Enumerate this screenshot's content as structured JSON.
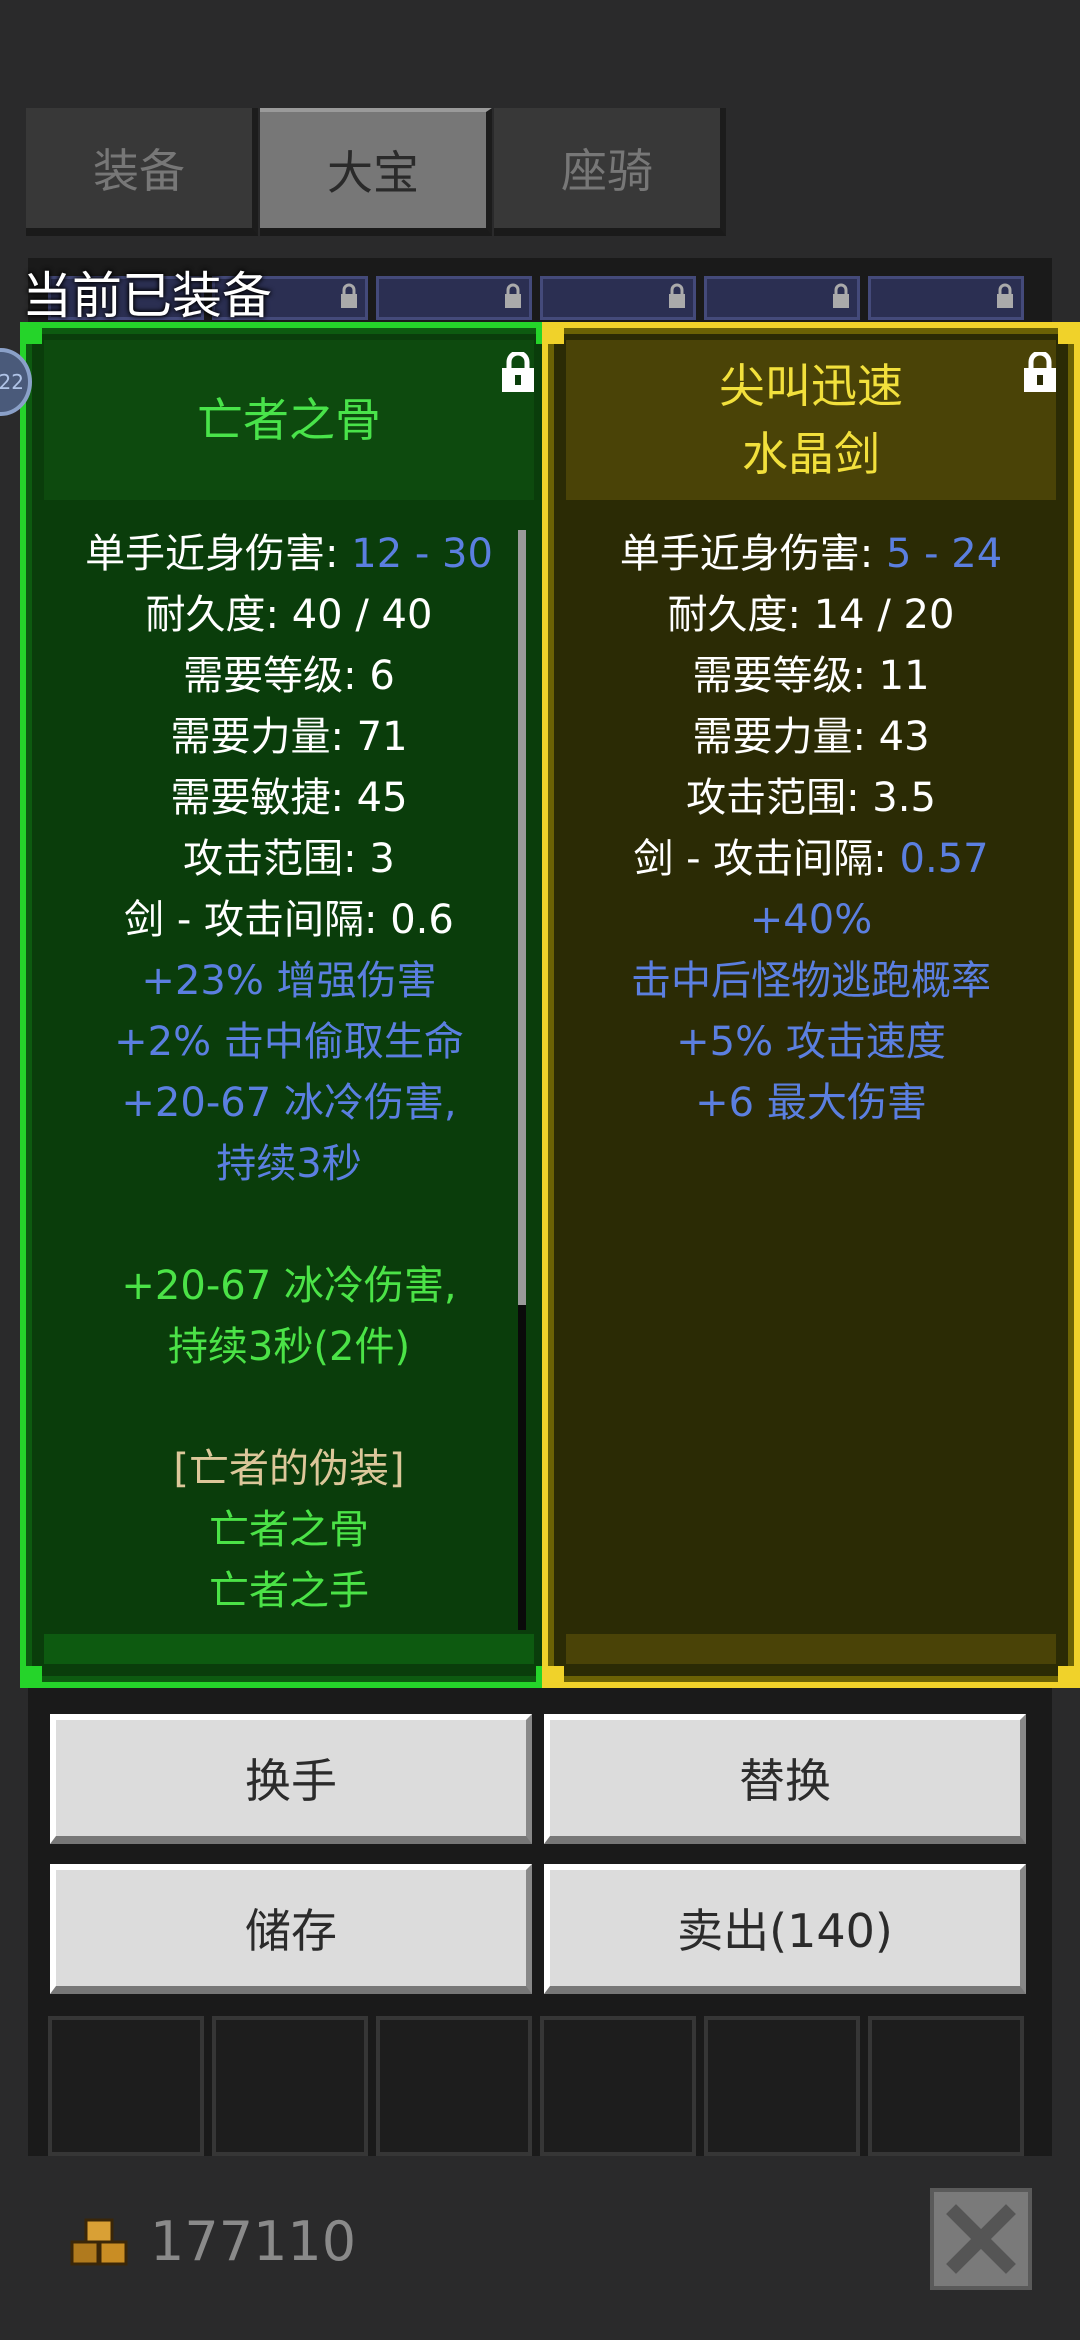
{
  "tabs": [
    {
      "label": "装备",
      "active": false
    },
    {
      "label": "大宝",
      "active": true
    },
    {
      "label": "座骑",
      "active": false
    }
  ],
  "equipped_label": "当前已装备",
  "avatar_level": "22",
  "left_item": {
    "name": "亡者之骨",
    "stats": {
      "damage_label": "单手近身伤害: ",
      "damage_value": "12 - 30",
      "durability": "耐久度: 40 / 40",
      "req_level": "需要等级: 6",
      "req_strength": "需要力量: 71",
      "req_dex": "需要敏捷: 45",
      "range": "攻击范围: 3",
      "interval": "剑 - 攻击间隔: 0.6"
    },
    "magic": [
      "+23% 增强伤害",
      "+2% 击中偷取生命",
      "+20-67 冰冷伤害,",
      "持续3秒"
    ],
    "set_bonus": [
      "+20-67 冰冷伤害,",
      "持续3秒(2件)"
    ],
    "set_name": "[亡者的伪装]",
    "set_items": [
      "亡者之骨",
      "亡者之手"
    ],
    "border_color": "#25d42a"
  },
  "right_item": {
    "name_line1": "尖叫迅速",
    "name_line2": "水晶剑",
    "stats": {
      "damage_label": "单手近身伤害: ",
      "damage_value": "5 - 24",
      "durability": "耐久度: 14 / 20",
      "req_level": "需要等级: 11",
      "req_strength": "需要力量: 43",
      "range": "攻击范围: 3.5",
      "interval_label": "剑 - 攻击间隔: ",
      "interval_value": "0.57"
    },
    "magic": [
      "+40%",
      "击中后怪物逃跑概率",
      "+5% 攻击速度",
      "+6 最大伤害"
    ],
    "border_color": "#f0d22a"
  },
  "buttons": {
    "swap_hand": "换手",
    "replace": "替换",
    "store": "储存",
    "sell": "卖出(140)"
  },
  "gold": "177110",
  "icons": [
    "lock-icon",
    "gold-coins-icon",
    "close-icon"
  ]
}
